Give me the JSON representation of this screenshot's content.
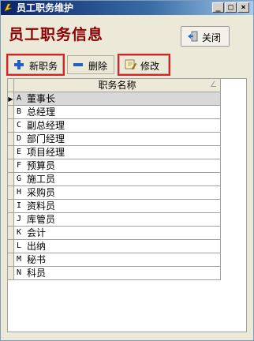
{
  "window": {
    "title": "员工职务维护"
  },
  "titlebar_buttons": {
    "minimize": "_",
    "maximize": "□",
    "close": "×"
  },
  "header": {
    "page_title": "员工职务信息",
    "close_label": "关闭"
  },
  "toolbar": {
    "new_label": "新职务",
    "delete_label": "删除",
    "edit_label": "修改"
  },
  "table": {
    "column": "职务名称",
    "sort_glyph": "∠",
    "current_marker": "▶",
    "rows": [
      {
        "code": "A",
        "name": "董事长"
      },
      {
        "code": "B",
        "name": "总经理"
      },
      {
        "code": "C",
        "name": "副总经理"
      },
      {
        "code": "D",
        "name": "部门经理"
      },
      {
        "code": "E",
        "name": "项目经理"
      },
      {
        "code": "F",
        "name": "预算员"
      },
      {
        "code": "G",
        "name": "施工员"
      },
      {
        "code": "H",
        "name": "采购员"
      },
      {
        "code": "I",
        "name": "资料员"
      },
      {
        "code": "J",
        "name": "库管员"
      },
      {
        "code": "K",
        "name": "会计"
      },
      {
        "code": "L",
        "name": "出纳"
      },
      {
        "code": "M",
        "name": "秘书"
      },
      {
        "code": "N",
        "name": "科员"
      }
    ]
  },
  "colors": {
    "title_accent": "#8b0000",
    "highlight": "#e02020"
  }
}
